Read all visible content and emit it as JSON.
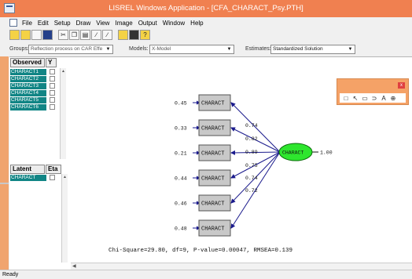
{
  "window": {
    "title": "LISREL Windows Application - [CFA_CHARACT_Psy.PTH]"
  },
  "menu": [
    "File",
    "Edit",
    "Setup",
    "Draw",
    "View",
    "Image",
    "Output",
    "Window",
    "Help"
  ],
  "toolbar_icons": [
    "new-document-icon",
    "open-folder-icon",
    "open-file-icon",
    "save-icon",
    "cut-icon",
    "copy-icon",
    "paste-icon",
    "model-icon",
    "model-alt-icon",
    "print-icon",
    "info-icon",
    "help-icon"
  ],
  "options": {
    "groups_label": "Groups:",
    "groups_value": "Reflection process on CAR Effe",
    "models_label": "Models:",
    "models_value": "X-Model",
    "estimates_label": "Estimates:",
    "estimates_value": "Standardized Solution"
  },
  "observed": {
    "header": "Observed",
    "header_y": "Y",
    "items": [
      "CHARACT1",
      "CHARACT2",
      "CHARACT3",
      "CHARACT4",
      "CHARACT5",
      "CHARACT6"
    ]
  },
  "latent": {
    "header": "Latent",
    "header_eta": "Eta",
    "items": [
      "CHARACT"
    ]
  },
  "diagram": {
    "indicators": [
      {
        "label": "CHARACT",
        "error": "0.45",
        "loading": "0.74"
      },
      {
        "label": "CHARACT",
        "error": "0.33",
        "loading": "0.82"
      },
      {
        "label": "CHARACT",
        "error": "0.21",
        "loading": "0.89"
      },
      {
        "label": "CHARACT",
        "error": "0.44",
        "loading": "0.75"
      },
      {
        "label": "CHARACT",
        "error": "0.46",
        "loading": "0.74"
      },
      {
        "label": "CHARACT",
        "error": "0.48",
        "loading": "0.72"
      }
    ],
    "latent_label": "CHARACT",
    "latent_variance": "1.00",
    "fit_text": "Chi-Square=29.80, df=9, P-value=0.00047, RMSEA=0.139"
  },
  "palette": {
    "close": "x",
    "tools": [
      "select-tool-icon",
      "arrow-tool-icon",
      "rectangle-tool-icon",
      "curved-arrow-tool-icon",
      "text-tool-icon",
      "zoom-tool-icon"
    ]
  },
  "status": "Ready",
  "colors": {
    "titlebar": "#f08050",
    "variable_highlight": "#118585",
    "latent_fill": "#2ee62e",
    "path_arrow": "#1a1a8c",
    "box_fill": "#c8c8c8"
  }
}
